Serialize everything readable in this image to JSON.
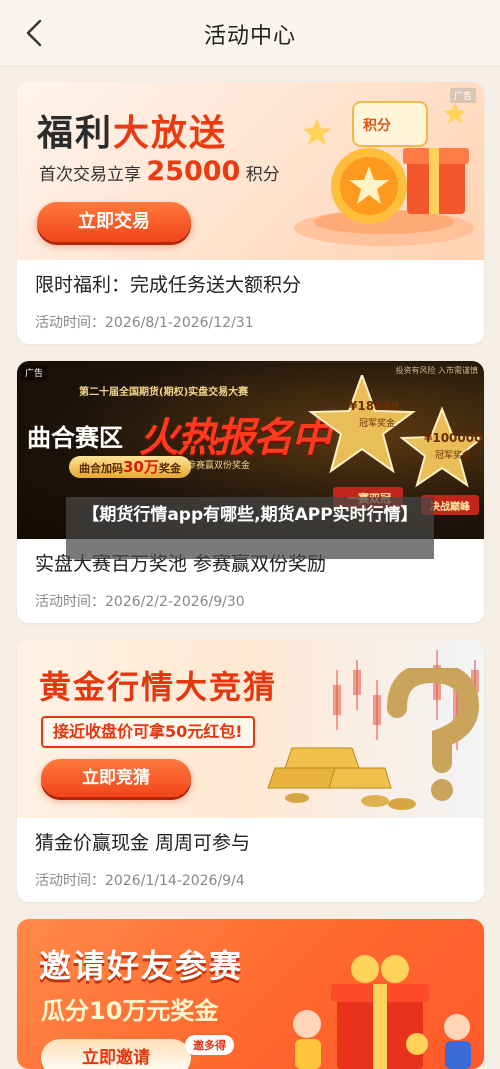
{
  "nav": {
    "title": "活动中心"
  },
  "cards": [
    {
      "banner": {
        "headline_a": "福利",
        "headline_b": "大放送",
        "subline_prefix": "首次交易立享",
        "subline_number": "25000",
        "subline_suffix": "积分",
        "button": "立即交易",
        "badge": "积分",
        "ad": "广告"
      },
      "title": "限时福利：完成任务送大额积分",
      "time": "活动时间：2026/8/1-2026/12/31"
    },
    {
      "banner": {
        "ad": "广告",
        "risk": "投资有风险 入市需谨慎",
        "top_line": "第二十届全国期货(期权)实盘交易大赛",
        "left_title": "曲合赛区",
        "big_title": "火热报名中",
        "bonus_prefix": "曲合加码",
        "bonus_amount": "30万",
        "bonus_suffix": "奖金",
        "double": "参赛赢双份奖金",
        "prize1": "¥18888",
        "prize1_label": "冠军奖金",
        "prize2": "¥100000",
        "prize2_label": "冠军奖金",
        "tag1": "一赛双冠",
        "tag2": "决战巅峰"
      },
      "title": "实盘大赛百万奖池 参赛赢双份奖励",
      "time": "活动时间：2026/2/2-2026/9/30"
    },
    {
      "banner": {
        "headline": "黄金行情大竞猜",
        "subline": "接近收盘价可拿50元红包!",
        "button": "立即竞猜"
      },
      "title": "猜金价赢现金 周周可参与",
      "time": "活动时间：2026/1/14-2026/9/4"
    },
    {
      "banner": {
        "headline": "邀请好友参赛",
        "subline": "瓜分10万元奖金",
        "button": "立即邀请",
        "bubble": "邀多得"
      }
    }
  ],
  "overlay": {
    "text": "【期货行情app有哪些,期货APP实时行情】"
  },
  "colors": {
    "accent": "#f1441a",
    "gold": "#e8b84a",
    "page_bg": "#f5efe6"
  }
}
